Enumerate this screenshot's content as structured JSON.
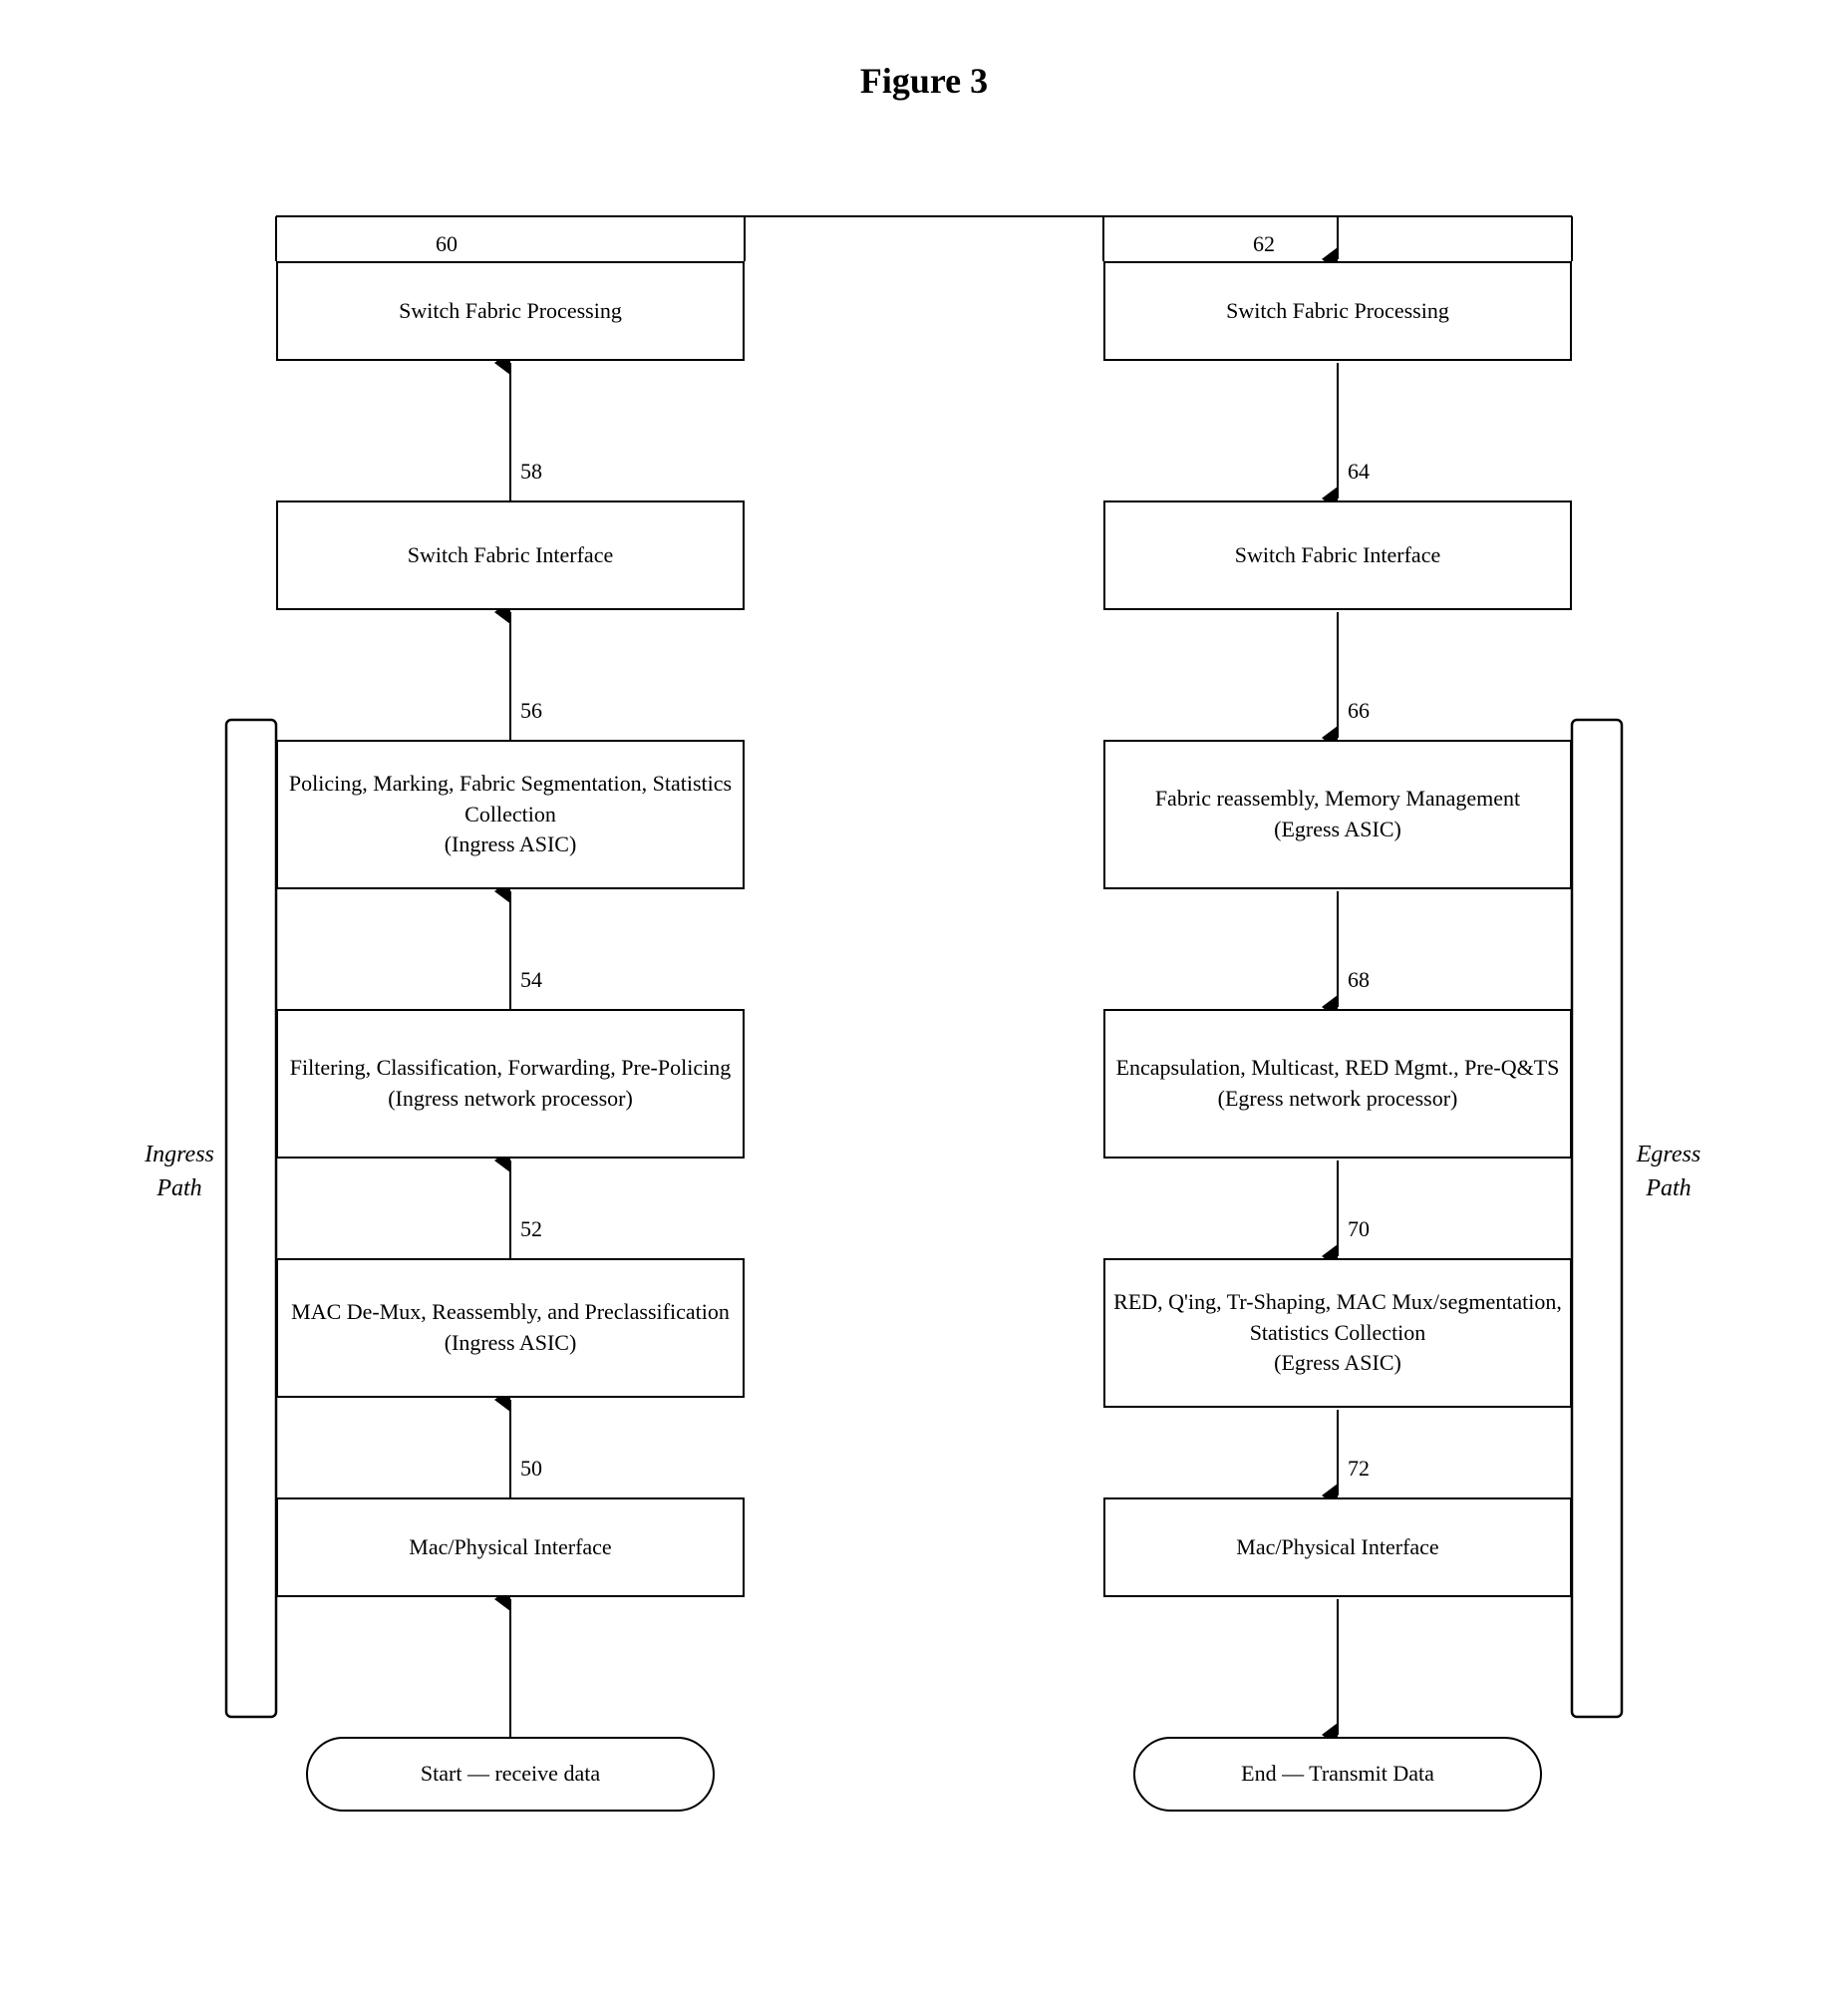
{
  "title": "Figure 3",
  "labels": {
    "ref60": "60",
    "ref62": "62",
    "ref58": "58",
    "ref64": "64",
    "ref56": "56",
    "ref66": "66",
    "ref54": "54",
    "ref68": "68",
    "ref52": "52",
    "ref70": "70",
    "ref50": "50",
    "ref72": "72",
    "ingressPath": "Ingress\nPath",
    "egressPath": "Egress\nPath"
  },
  "boxes": {
    "leftSFP": "Switch Fabric Processing",
    "leftSFI": "Switch Fabric Interface",
    "leftIngressASIC": "Policing, Marking, Fabric Segmentation, Statistics Collection\n(Ingress ASIC)",
    "leftNP": "Filtering, Classification, Forwarding, Pre-Policing\n(Ingress network processor)",
    "leftMACDemux": "MAC De-Mux, Reassembly, and Preclassification\n(Ingress ASIC)",
    "leftMACPhys": "Mac/Physical Interface",
    "leftStart": "Start — receive data",
    "rightSFP": "Switch Fabric Processing",
    "rightSFI": "Switch Fabric Interface",
    "rightEgressASIC1": "Fabric reassembly, Memory Management\n(Egress ASIC)",
    "rightNP": "Encapsulation, Multicast, RED Mgmt., Pre-Q&TS\n(Egress network processor)",
    "rightEgressASIC2": "RED, Q'ing, Tr-Shaping, MAC Mux/segmentation, Statistics Collection\n(Egress ASIC)",
    "rightMACPhys": "Mac/Physical Interface",
    "rightEnd": "End — Transmit Data"
  }
}
